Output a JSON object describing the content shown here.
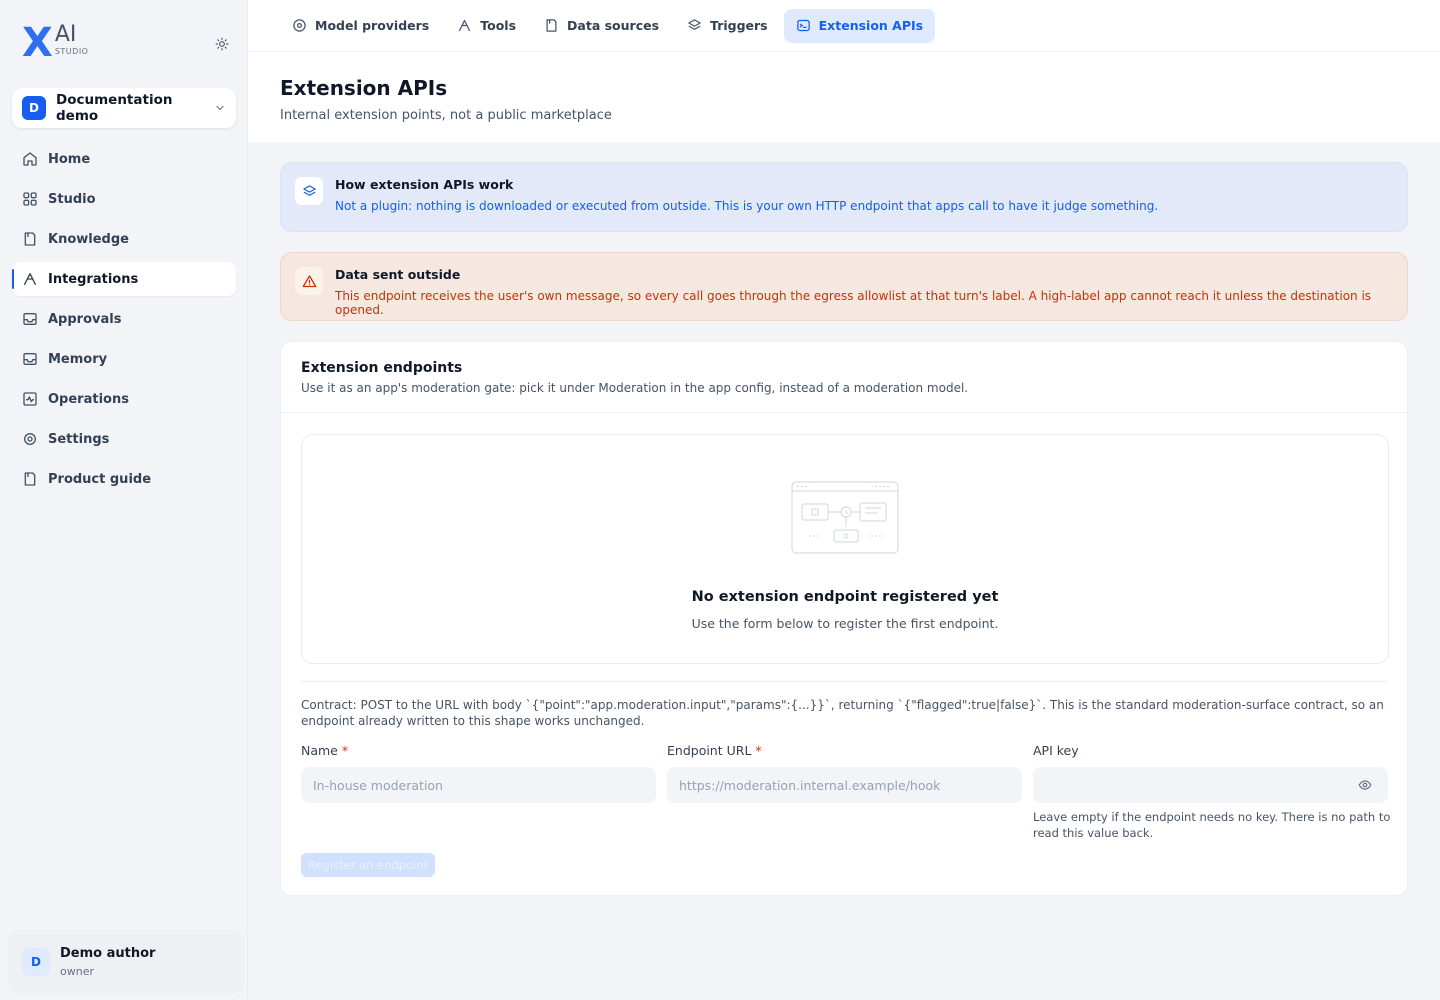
{
  "brand": {
    "logo_x": "X",
    "logo_ai": "AI",
    "logo_studio": "STUDIO"
  },
  "workspace": {
    "badge": "D",
    "name": "Documentation demo"
  },
  "nav": [
    {
      "label": "Home",
      "icon": "home-icon"
    },
    {
      "label": "Studio",
      "icon": "grid-icon"
    },
    {
      "label": "Knowledge",
      "icon": "book-icon"
    },
    {
      "label": "Integrations",
      "icon": "integration-icon",
      "active": true
    },
    {
      "label": "Approvals",
      "icon": "inbox-icon"
    },
    {
      "label": "Memory",
      "icon": "inbox-icon"
    },
    {
      "label": "Operations",
      "icon": "activity-icon"
    },
    {
      "label": "Settings",
      "icon": "gear-icon"
    },
    {
      "label": "Product guide",
      "icon": "book-icon"
    }
  ],
  "user": {
    "avatar": "D",
    "name": "Demo author",
    "role": "owner"
  },
  "tabs": [
    {
      "label": "Model providers",
      "icon": "provider-icon"
    },
    {
      "label": "Tools",
      "icon": "tools-icon"
    },
    {
      "label": "Data sources",
      "icon": "document-icon"
    },
    {
      "label": "Triggers",
      "icon": "layers-icon"
    },
    {
      "label": "Extension APIs",
      "icon": "terminal-icon",
      "active": true
    }
  ],
  "page": {
    "title": "Extension APIs",
    "subtitle": "Internal extension points, not a public marketplace"
  },
  "info_alert": {
    "title": "How extension APIs work",
    "body": "Not a plugin: nothing is downloaded or executed from outside. This is your own HTTP endpoint that apps call to have it judge something."
  },
  "warn_alert": {
    "title": "Data sent outside",
    "body": "This endpoint receives the user's own message, so every call goes through the egress allowlist at that turn's label. A high-label app cannot reach it unless the destination is opened."
  },
  "card": {
    "title": "Extension endpoints",
    "description": "Use it as an app's moderation gate: pick it under Moderation in the app config, instead of a moderation model.",
    "empty_title": "No extension endpoint registered yet",
    "empty_desc": "Use the form below to register the first endpoint.",
    "contract": "Contract: POST to the URL with body `{\"point\":\"app.moderation.input\",\"params\":{...}}`, returning `{\"flagged\":true|false}`. This is the standard moderation-surface contract, so an endpoint already written to this shape works unchanged."
  },
  "form": {
    "name_label": "Name",
    "name_placeholder": "In-house moderation",
    "url_label": "Endpoint URL",
    "url_placeholder": "https://moderation.internal.example/hook",
    "key_label": "API key",
    "key_placeholder": "",
    "required_mark": "*",
    "key_hint": "Leave empty if the endpoint needs no key. There is no path to read this value back.",
    "submit_label": "Register an endpoint"
  },
  "colors": {
    "accent": "#155eef",
    "warn": "#c4320a",
    "required": "#d92d20"
  }
}
